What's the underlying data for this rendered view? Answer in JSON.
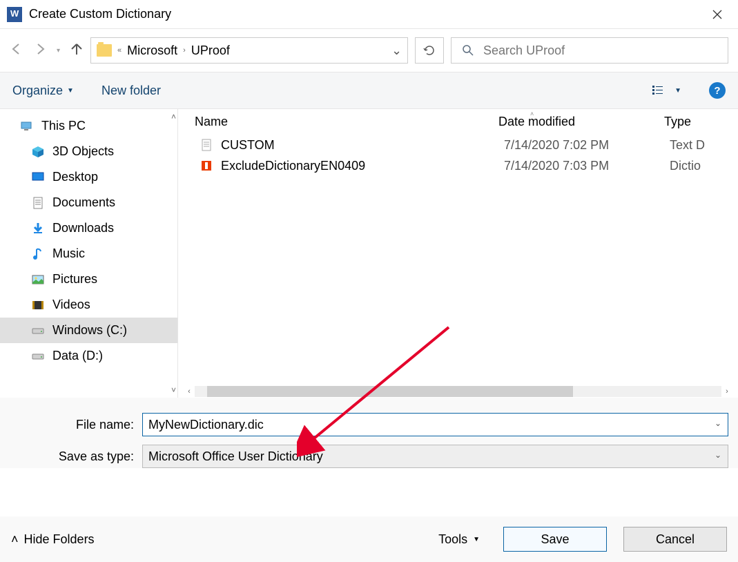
{
  "titlebar": {
    "title": "Create Custom Dictionary"
  },
  "breadcrumb": {
    "parent": "Microsoft",
    "current": "UProof"
  },
  "search": {
    "placeholder": "Search UProof"
  },
  "toolbar": {
    "organize": "Organize",
    "new_folder": "New folder"
  },
  "tree": {
    "root": "This PC",
    "items": [
      {
        "label": "3D Objects",
        "icon": "cube"
      },
      {
        "label": "Desktop",
        "icon": "desktop"
      },
      {
        "label": "Documents",
        "icon": "doc"
      },
      {
        "label": "Downloads",
        "icon": "download"
      },
      {
        "label": "Music",
        "icon": "music"
      },
      {
        "label": "Pictures",
        "icon": "picture"
      },
      {
        "label": "Videos",
        "icon": "video"
      },
      {
        "label": "Windows (C:)",
        "icon": "drive",
        "selected": true
      },
      {
        "label": "Data (D:)",
        "icon": "drive"
      }
    ]
  },
  "columns": {
    "name": "Name",
    "date": "Date modified",
    "type": "Type"
  },
  "files": [
    {
      "name": "CUSTOM",
      "date": "7/14/2020 7:02 PM",
      "type": "Text D",
      "icon": "text"
    },
    {
      "name": "ExcludeDictionaryEN0409",
      "date": "7/14/2020 7:03 PM",
      "type": "Dictio",
      "icon": "office"
    }
  ],
  "form": {
    "filename_label": "File name:",
    "filename_value": "MyNewDictionary.dic",
    "type_label": "Save as type:",
    "type_value": "Microsoft Office User Dictionary"
  },
  "footer": {
    "hide": "Hide Folders",
    "tools": "Tools",
    "save": "Save",
    "cancel": "Cancel"
  }
}
